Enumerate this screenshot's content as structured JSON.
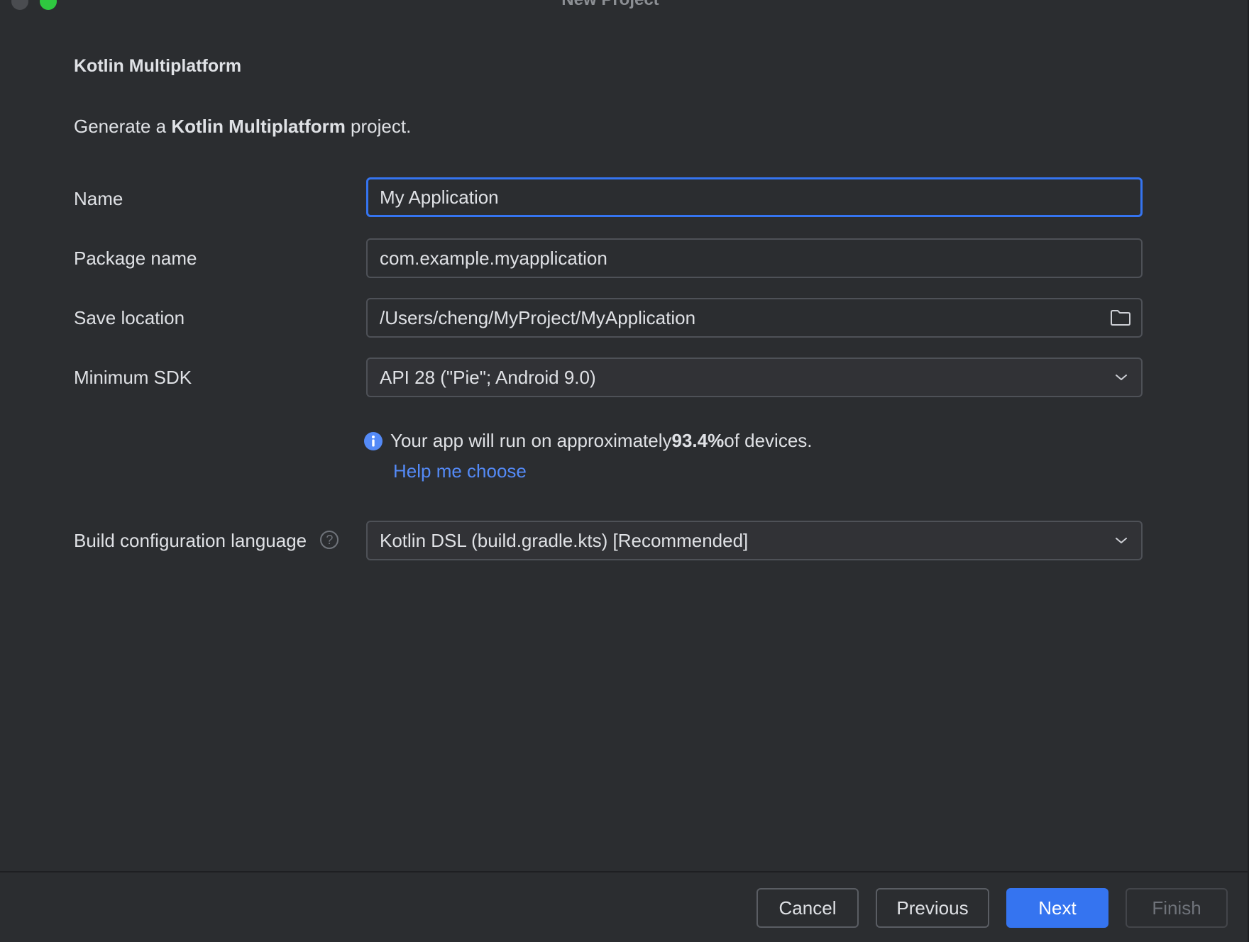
{
  "window": {
    "title": "New Project"
  },
  "page": {
    "section_title": "Kotlin Multiplatform",
    "subtitle_prefix": "Generate a ",
    "subtitle_bold": "Kotlin Multiplatform",
    "subtitle_suffix": " project."
  },
  "form": {
    "name": {
      "label": "Name",
      "value": "My Application"
    },
    "package": {
      "label": "Package name",
      "value": "com.example.myapplication"
    },
    "location": {
      "label": "Save location",
      "value": "/Users/cheng/MyProject/MyApplication",
      "icon": "folder-icon"
    },
    "min_sdk": {
      "label": "Minimum SDK",
      "value": "API 28 (\"Pie\"; Android 9.0)",
      "icon": "chevron-down-icon"
    },
    "info": {
      "icon": "info-icon",
      "prefix": "Your app will run on approximately ",
      "percent": "93.4%",
      "suffix": " of devices.",
      "help_link": "Help me choose"
    },
    "build_lang": {
      "label": "Build configuration language",
      "help_icon": "question-icon",
      "help_glyph": "?",
      "value": "Kotlin DSL (build.gradle.kts) [Recommended]",
      "icon": "chevron-down-icon"
    }
  },
  "footer": {
    "cancel": "Cancel",
    "previous": "Previous",
    "next": "Next",
    "finish": "Finish"
  },
  "colors": {
    "background": "#2b2d30",
    "accent": "#3574f0",
    "link": "#548af7",
    "traffic_green": "#2fc840"
  }
}
